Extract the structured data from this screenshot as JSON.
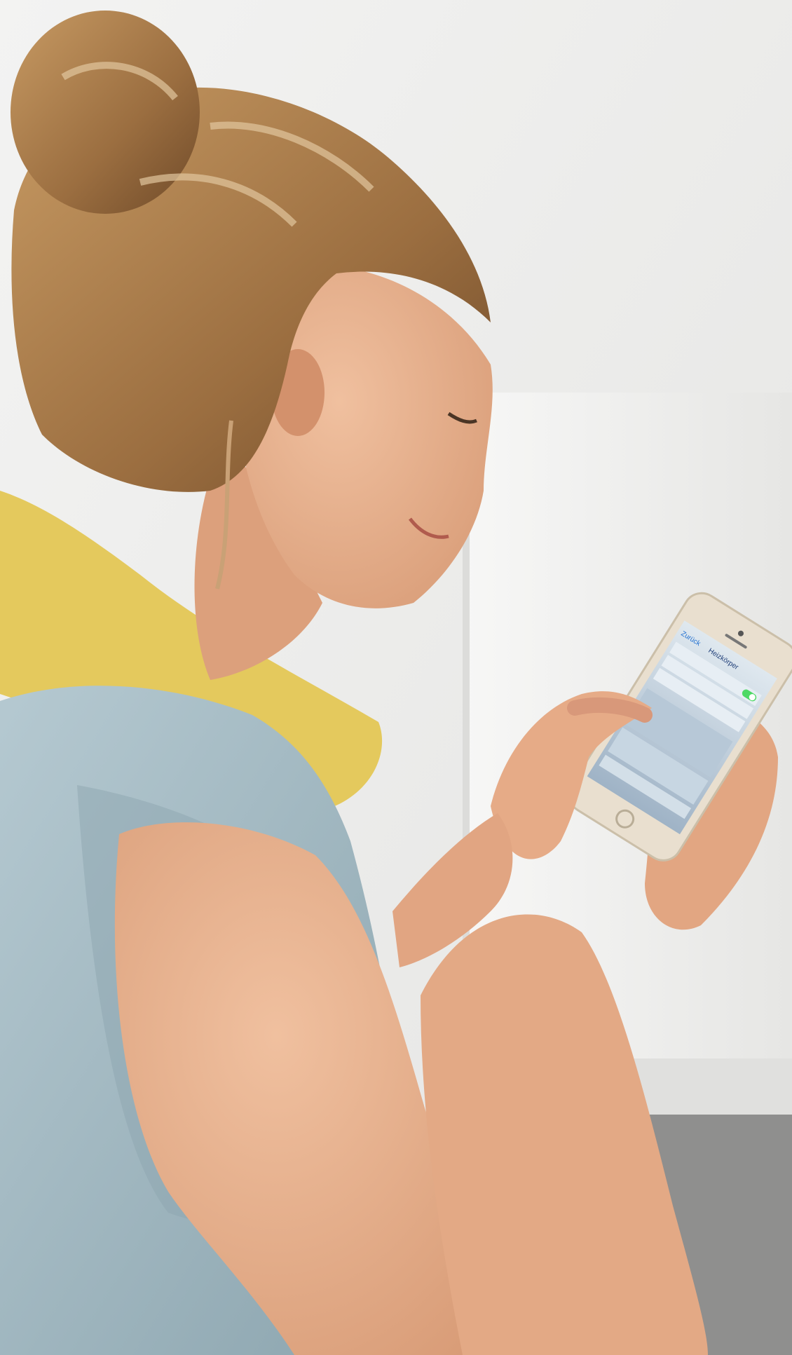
{
  "scene": {
    "colors": {
      "wall": "#ebebea",
      "wall_light": "#f6f6f5",
      "radiator": "#f4f4f2",
      "floor": "#8f8f8e",
      "cushion": "#e4c95d",
      "skin": "#e8b18f",
      "skin_shadow": "#c98d6b",
      "hair": "#b98c58",
      "hair_dark": "#7d5532",
      "hair_light": "#dcc09a",
      "tank_top": "#a9bfc7",
      "tank_top_shadow": "#8ea6af",
      "phone_body": "#e9dfcf",
      "phone_screen": "#c9d7e2",
      "switch_on": "#4cd964"
    },
    "phone_screen": {
      "back_label": "Zurück",
      "title": "Heizkörper"
    }
  }
}
